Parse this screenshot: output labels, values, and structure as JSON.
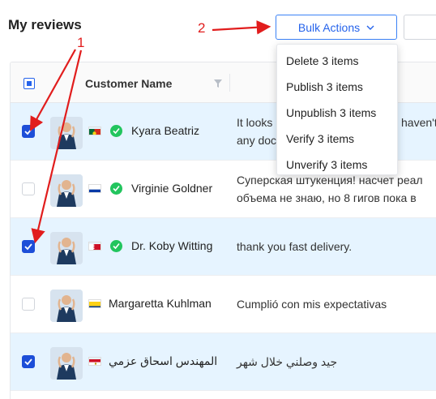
{
  "header": {
    "title": "My reviews",
    "bulk_actions_label": "Bulk Actions"
  },
  "annotations": {
    "step1": "1",
    "step2": "2",
    "arrow_color": "#e11d1d"
  },
  "table": {
    "columns": [
      "Customer Name"
    ],
    "rows": [
      {
        "selected": true,
        "name": "Kyara Beatriz",
        "verified": true,
        "flag": "portugal",
        "review_lines": [
          "It looks",
          "any doc"
        ]
      },
      {
        "selected": false,
        "name": "Virginie Goldner",
        "verified": true,
        "flag": "russia",
        "review_lines": [
          "Суперская штукенция! насчет реал",
          "объема не знаю, но 8 гигов пока в"
        ]
      },
      {
        "selected": true,
        "name": "Dr. Koby Witting",
        "verified": true,
        "flag": "bahrain",
        "review_lines": [
          "thank you fast delivery."
        ]
      },
      {
        "selected": false,
        "name": "Margaretta Kuhlman",
        "verified": false,
        "flag": "colombia",
        "review_lines": [
          "Cumplió con mis expectativas"
        ]
      },
      {
        "selected": true,
        "name": "المهندس اسحاق عزمي",
        "verified": false,
        "flag": "egypt",
        "review_lines": [
          "جيد وصلني خلال شهر"
        ]
      }
    ],
    "partial_review_text": "haven't"
  },
  "bulk_menu": {
    "items": [
      "Delete 3 items",
      "Publish 3 items",
      "Unpublish 3 items",
      "Verify 3 items",
      "Unverify 3 items"
    ]
  },
  "colors": {
    "accent": "#2563eb",
    "selected_row": "#e6f4ff",
    "verified": "#22c55e"
  }
}
